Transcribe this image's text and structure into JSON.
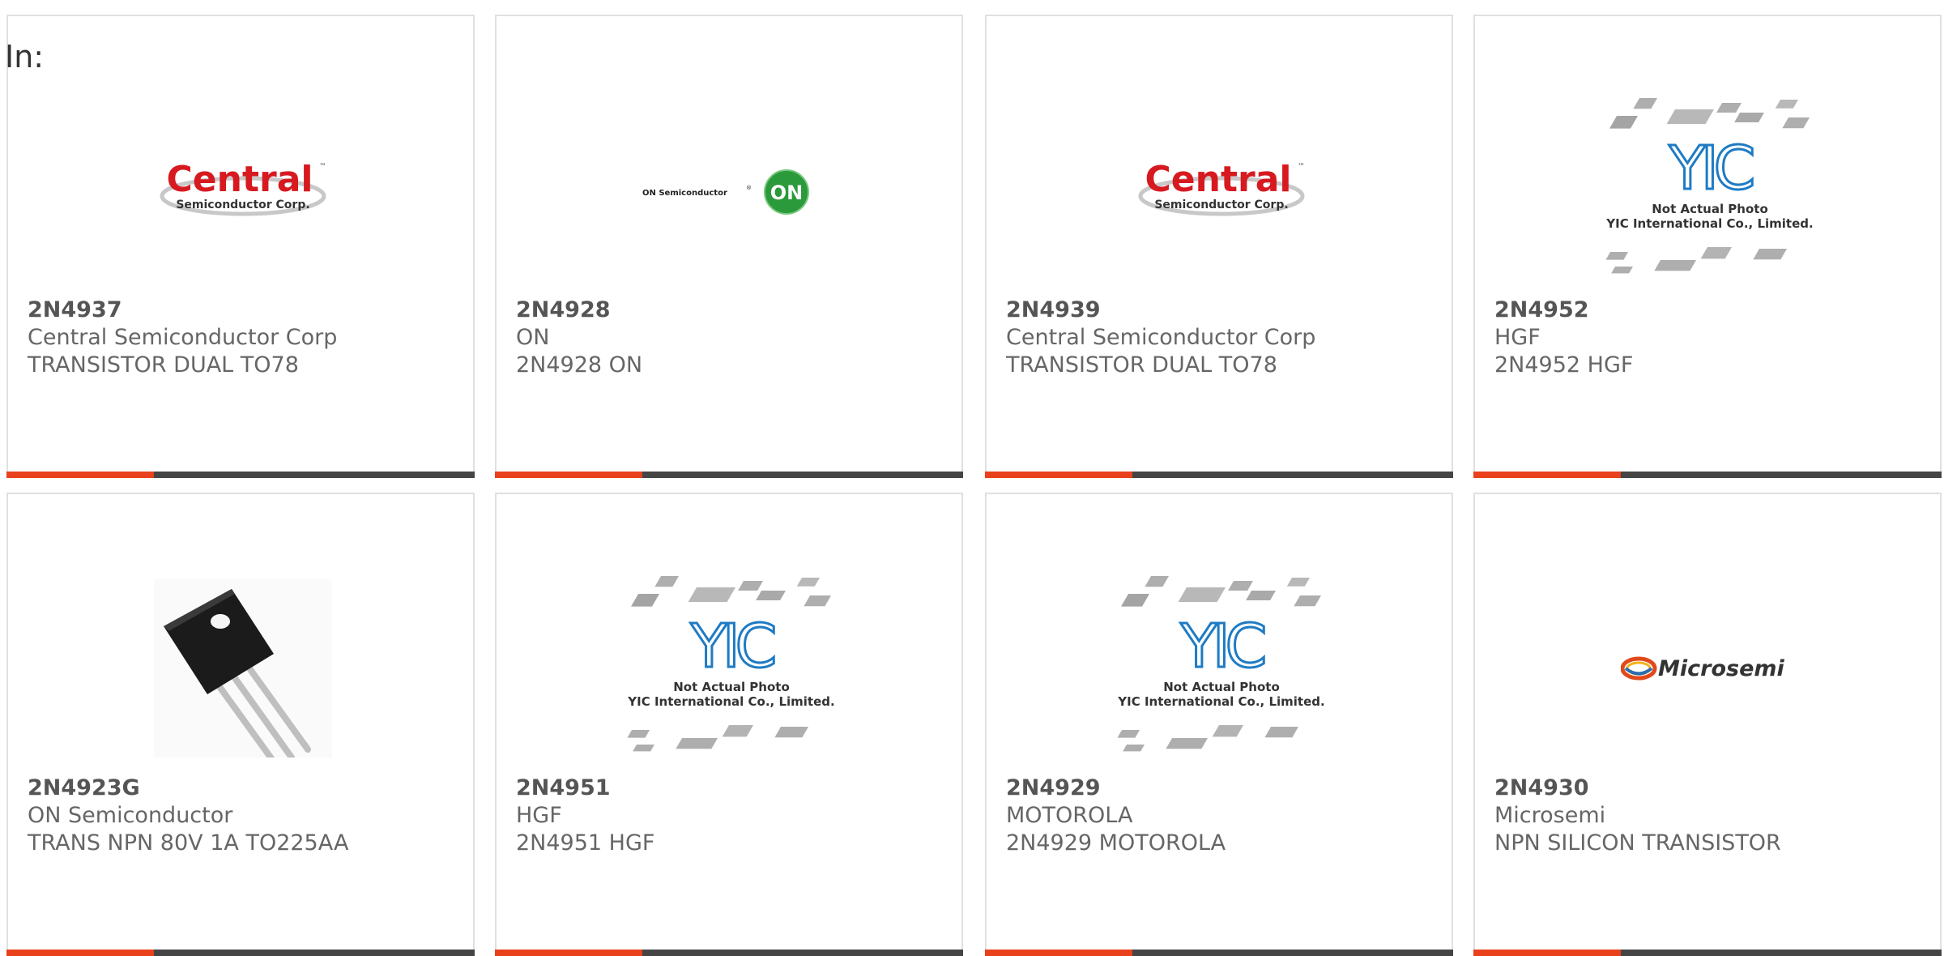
{
  "header": {
    "in_label": "In:"
  },
  "products": [
    {
      "part": "2N4937",
      "manufacturer": "Central Semiconductor Corp",
      "description": "TRANSISTOR DUAL TO78",
      "image": "central-logo"
    },
    {
      "part": "2N4928",
      "manufacturer": "ON",
      "description": "2N4928 ON",
      "image": "on-semi-logo"
    },
    {
      "part": "2N4939",
      "manufacturer": "Central Semiconductor Corp",
      "description": "TRANSISTOR DUAL TO78",
      "image": "central-logo"
    },
    {
      "part": "2N4952",
      "manufacturer": "HGF",
      "description": "2N4952 HGF",
      "image": "yic-placeholder"
    },
    {
      "part": "2N4923G",
      "manufacturer": "ON Semiconductor",
      "description": "TRANS NPN 80V 1A TO225AA",
      "image": "to225-photo"
    },
    {
      "part": "2N4951",
      "manufacturer": "HGF",
      "description": "2N4951 HGF",
      "image": "yic-placeholder"
    },
    {
      "part": "2N4929",
      "manufacturer": "MOTOROLA",
      "description": "2N4929 MOTOROLA",
      "image": "yic-placeholder"
    },
    {
      "part": "2N4930",
      "manufacturer": "Microsemi",
      "description": "NPN SILICON TRANSISTOR",
      "image": "microsemi-logo"
    }
  ],
  "logos": {
    "central_word": "Central",
    "central_tm": "™",
    "central_sub": "Semiconductor Corp.",
    "on_text": "ON Semiconductor",
    "on_reg": "®",
    "on_badge": "ON",
    "yic_letters": "YIC",
    "yic_line1": "Not Actual Photo",
    "yic_line2": "YIC International Co., Limited.",
    "microsemi_word": "Microsemi"
  },
  "colors": {
    "accent": "#e8411c",
    "bar": "#454545",
    "border": "#e0e0e0",
    "central_red": "#d71920",
    "on_green": "#2a9a3a",
    "yic_blue": "#1e7bc4"
  }
}
